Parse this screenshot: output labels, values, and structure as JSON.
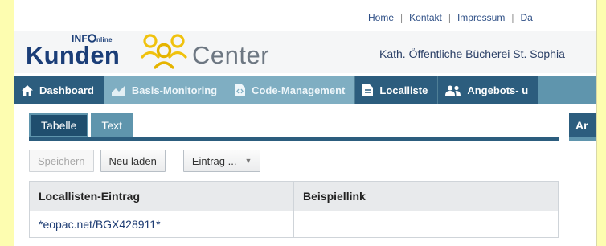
{
  "top_links": [
    "Home",
    "Kontakt",
    "Impressum",
    "Da"
  ],
  "logo": {
    "brand_prefix": "INF",
    "brand_suffix": "nline",
    "word1": "Kunden",
    "word2": "Center",
    "people_colors": [
      "#f5c518",
      "#f2d24a",
      "#e8b90f"
    ]
  },
  "library_name": "Kath. Öffentliche Bücherei St. Sophia",
  "nav": {
    "items": [
      {
        "label": "Dashboard",
        "icon": "home-icon"
      },
      {
        "label": "Basis-Monitoring",
        "icon": "chart-icon"
      },
      {
        "label": "Code-Management",
        "icon": "code-file-icon"
      },
      {
        "label": "Localliste",
        "icon": "document-icon"
      },
      {
        "label": "Angebots- u",
        "icon": "users-icon"
      }
    ],
    "active": "Localliste"
  },
  "subtabs": {
    "tabs": [
      {
        "label": "Tabelle"
      },
      {
        "label": "Text"
      }
    ],
    "active": "Tabelle",
    "right_tab": "Ar"
  },
  "toolbar": {
    "save_label": "Speichern",
    "reload_label": "Neu laden",
    "entry_label": "Eintrag ..."
  },
  "table": {
    "columns": [
      "Locallisten-Eintrag",
      "Beispiellink"
    ],
    "rows": [
      [
        "*eopac.net/BGX428911*",
        ""
      ]
    ]
  },
  "colors": {
    "brand_dark": "#1b3e78",
    "nav_bg": "#5f95ad",
    "nav_active": "#2c5d7e",
    "page_outer": "#fdfdb0"
  }
}
